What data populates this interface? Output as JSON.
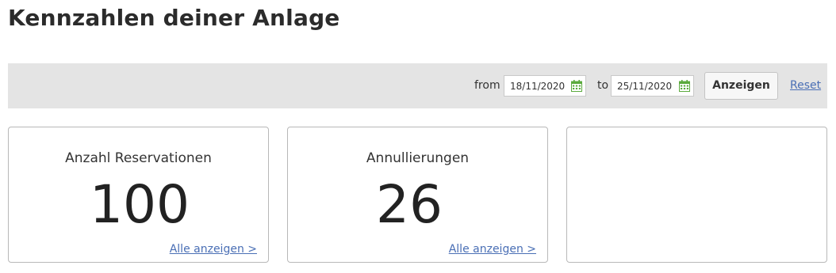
{
  "page": {
    "title": "Kennzahlen deiner Anlage"
  },
  "filter": {
    "from_label": "from",
    "from_value": "18/11/2020",
    "to_label": "to",
    "to_value": "25/11/2020",
    "show_button": "Anzeigen",
    "reset_link": "Reset",
    "calendar_icon": "calendar-icon",
    "calendar_icon_color": "#5aaa3c"
  },
  "cards": [
    {
      "title": "Anzahl Reservationen",
      "value": "100",
      "link": "Alle anzeigen >"
    },
    {
      "title": "Annullierungen",
      "value": "26",
      "link": "Alle anzeigen >"
    },
    {
      "title": "",
      "value": "",
      "link": ""
    }
  ],
  "colors": {
    "filter_bar_bg": "#e4e4e4",
    "link": "#4a6fb5",
    "card_border": "#b8b8b8"
  }
}
